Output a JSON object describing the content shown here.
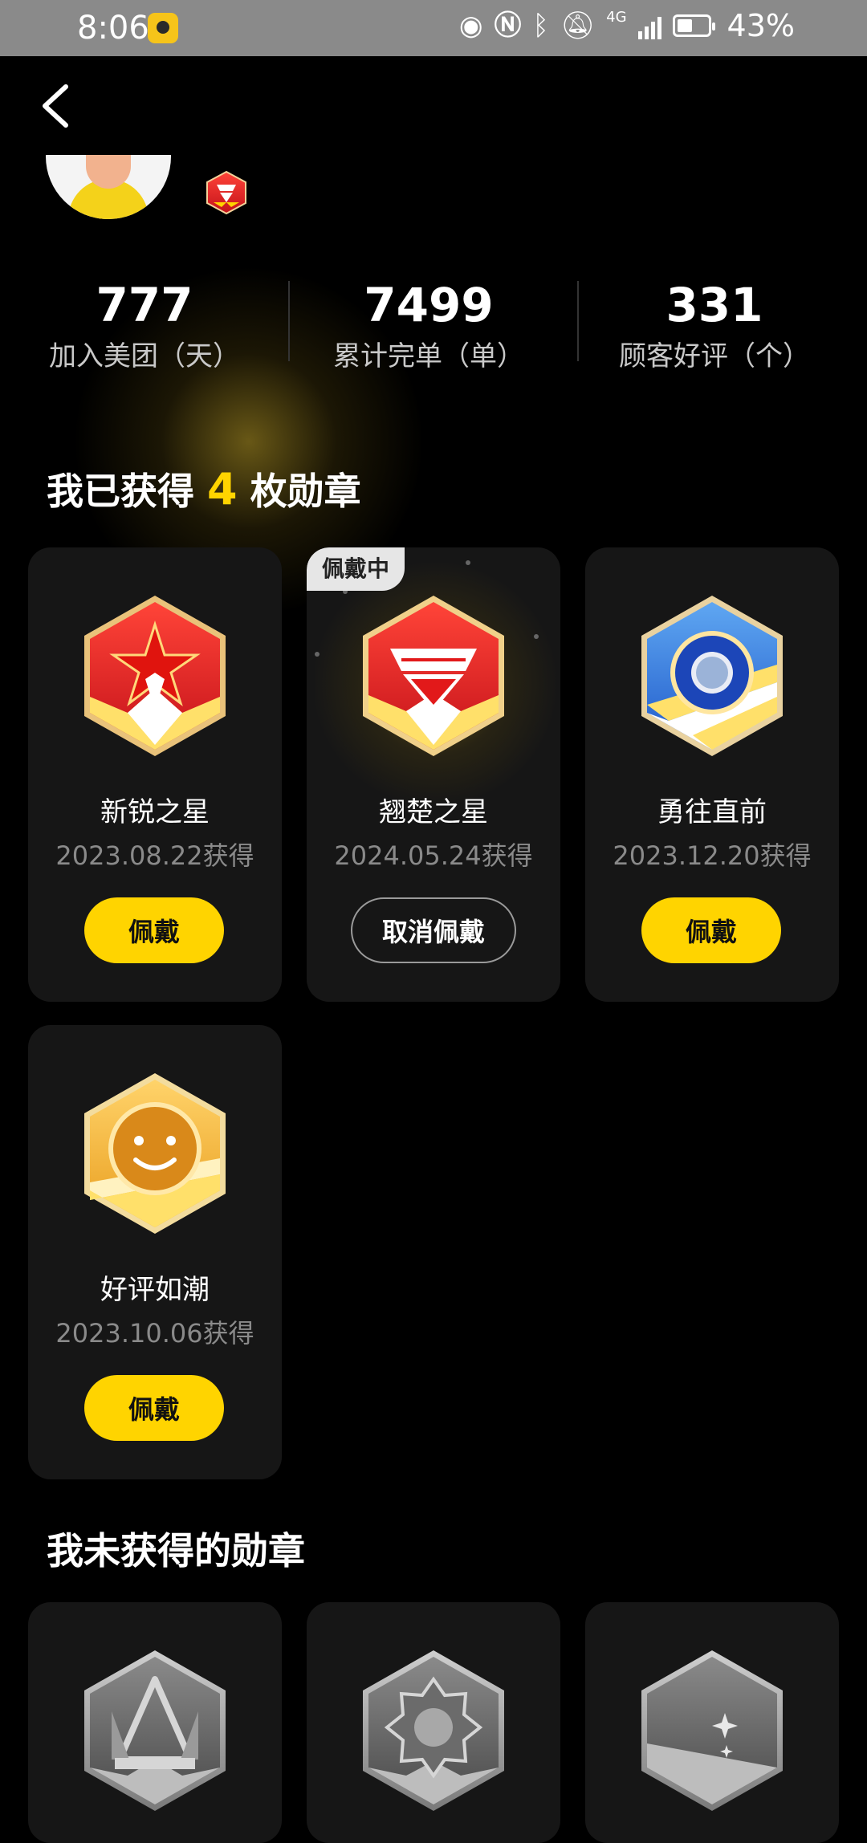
{
  "status_bar": {
    "time": "8:06",
    "battery": "43%",
    "icons": [
      "app-icon",
      "eye-icon",
      "nfc-icon",
      "bluetooth-icon",
      "mute-icon",
      "signal-icon",
      "battery-icon"
    ],
    "network_label": "4G"
  },
  "profile": {
    "badge_icon": "red-gem-badge"
  },
  "stats": [
    {
      "value": "777",
      "label": "加入美团（天）"
    },
    {
      "value": "7499",
      "label": "累计完单（单）"
    },
    {
      "value": "331",
      "label": "顾客好评（个）"
    }
  ],
  "earned_section": {
    "title_prefix": "我已获得",
    "count": "4",
    "title_suffix": "枚勋章"
  },
  "earned_badges": [
    {
      "name": "新锐之星",
      "date": "2023.08.22获得",
      "button": "佩戴",
      "icon": "red-star-medal"
    },
    {
      "name": "翘楚之星",
      "date": "2024.05.24获得",
      "button": "取消佩戴",
      "tag": "佩戴中",
      "icon": "red-gem-medal"
    },
    {
      "name": "勇往直前",
      "date": "2023.12.20获得",
      "button": "佩戴",
      "icon": "blue-target-medal"
    },
    {
      "name": "好评如潮",
      "date": "2023.10.06获得",
      "button": "佩戴",
      "icon": "gold-smile-medal"
    }
  ],
  "unearned_section": {
    "title": "我未获得的勋章"
  },
  "unearned_badges": [
    {
      "icon": "gray-crown-medal"
    },
    {
      "icon": "gray-gear-medal"
    },
    {
      "icon": "gray-moon-medal"
    }
  ],
  "colors": {
    "accent": "#ffd400",
    "background": "#000000",
    "card": "#161616"
  }
}
